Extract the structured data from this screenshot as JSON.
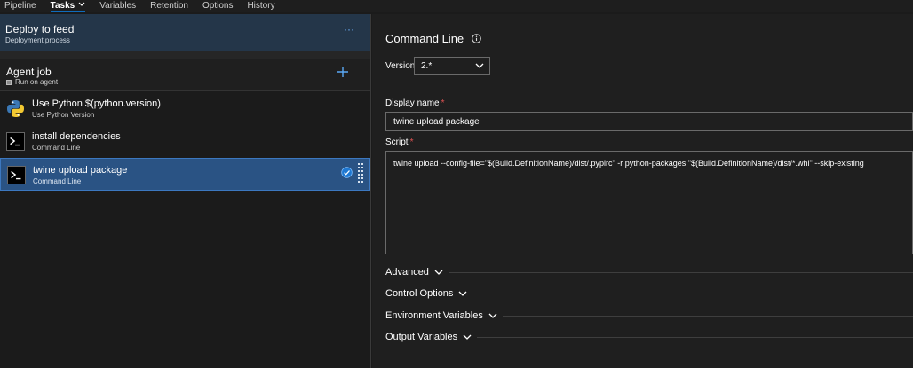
{
  "nav": {
    "tabs": [
      {
        "label": "Pipeline"
      },
      {
        "label": "Tasks"
      },
      {
        "label": "Variables"
      },
      {
        "label": "Retention"
      },
      {
        "label": "Options"
      },
      {
        "label": "History"
      }
    ],
    "active_tab": "Tasks"
  },
  "stage": {
    "title": "Deploy to feed",
    "subtitle": "Deployment process",
    "more_label": "···"
  },
  "agent_job": {
    "title": "Agent job",
    "subtitle": "Run on agent"
  },
  "tasks": [
    {
      "name": "Use Python $(python.version)",
      "type": "Use Python Version",
      "icon": "python-icon"
    },
    {
      "name": "install dependencies",
      "type": "Command Line",
      "icon": "terminal-icon"
    },
    {
      "name": "twine upload package",
      "type": "Command Line",
      "icon": "terminal-icon",
      "selected": true
    }
  ],
  "detail": {
    "title": "Command Line",
    "version_label": "Version",
    "version_value": "2.*",
    "display_name_label": "Display name",
    "display_name_value": "twine upload package",
    "script_label": "Script",
    "script_value": "twine upload --config-file=\"$(Build.DefinitionName)/dist/.pypirc\" -r python-packages \"$(Build.DefinitionName)/dist/*.whl\" --skip-existing",
    "required_marker": "*",
    "sections": [
      {
        "label": "Advanced"
      },
      {
        "label": "Control Options"
      },
      {
        "label": "Environment Variables"
      },
      {
        "label": "Output Variables"
      }
    ]
  },
  "colors": {
    "accent": "#0f6cbd",
    "selected_bg": "#2a5384",
    "stage_bg": "#243649",
    "required": "#e05252"
  }
}
